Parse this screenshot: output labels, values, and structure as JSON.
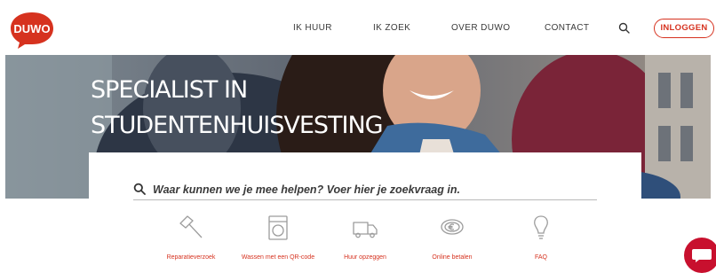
{
  "brand": {
    "logo_text": "DUWO",
    "primary_color": "#d6321f"
  },
  "nav": {
    "items": [
      {
        "label": "IK HUUR"
      },
      {
        "label": "IK ZOEK"
      },
      {
        "label": "OVER DUWO"
      },
      {
        "label": "CONTACT"
      }
    ],
    "search_icon": "search-icon",
    "login_label": "INLOGGEN"
  },
  "hero": {
    "title_line1": "Specialist in",
    "title_line2": "Studentenhuisvesting"
  },
  "search": {
    "placeholder": "Waar kunnen we je mee helpen? Voer hier je zoekvraag in.",
    "icon": "search-icon"
  },
  "quick_links": [
    {
      "label": "Reparatieverzoek",
      "icon": "hammer-icon"
    },
    {
      "label": "Wassen met een QR-code",
      "icon": "washing-machine-icon"
    },
    {
      "label": "Huur opzeggen",
      "icon": "moving-truck-icon"
    },
    {
      "label": "Online betalen",
      "icon": "euro-coin-icon"
    },
    {
      "label": "FAQ",
      "icon": "lightbulb-icon"
    }
  ],
  "chat": {
    "icon": "chat-icon",
    "color": "#c8102e"
  }
}
